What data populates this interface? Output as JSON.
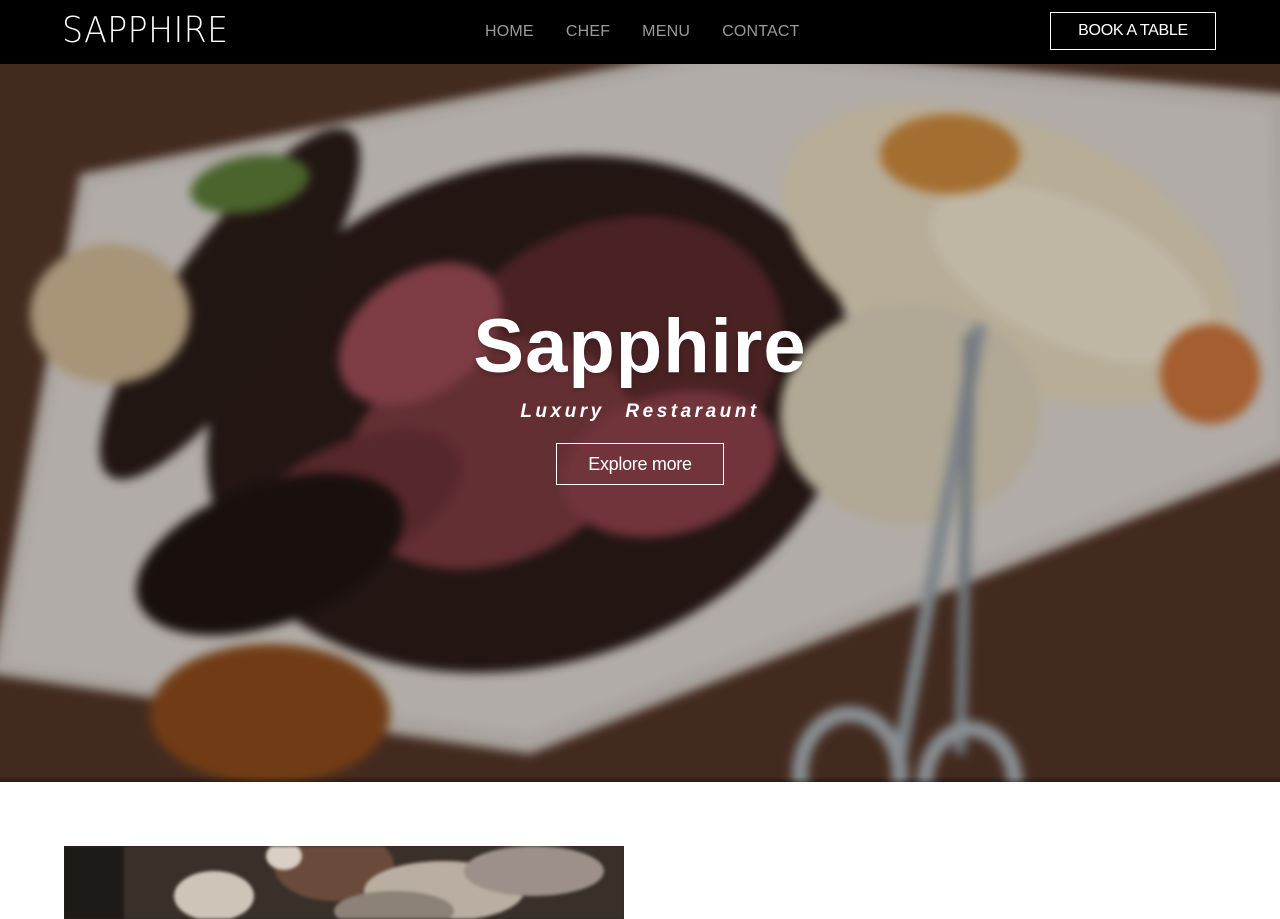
{
  "navbar": {
    "logo": "SAPPHIRE",
    "links": [
      {
        "label": "HOME"
      },
      {
        "label": "CHEF"
      },
      {
        "label": "MENU"
      },
      {
        "label": "CONTACT"
      }
    ],
    "book_label": "BOOK A TABLE"
  },
  "hero": {
    "title": "Sapphire",
    "subtitle": "Luxury Restaraunt",
    "explore_label": "Explore more"
  },
  "colors": {
    "navbar_bg": "#000000",
    "nav_link": "#9a9a9a",
    "text_light": "#ffffff",
    "page_bg": "#ffffff"
  },
  "icons": []
}
